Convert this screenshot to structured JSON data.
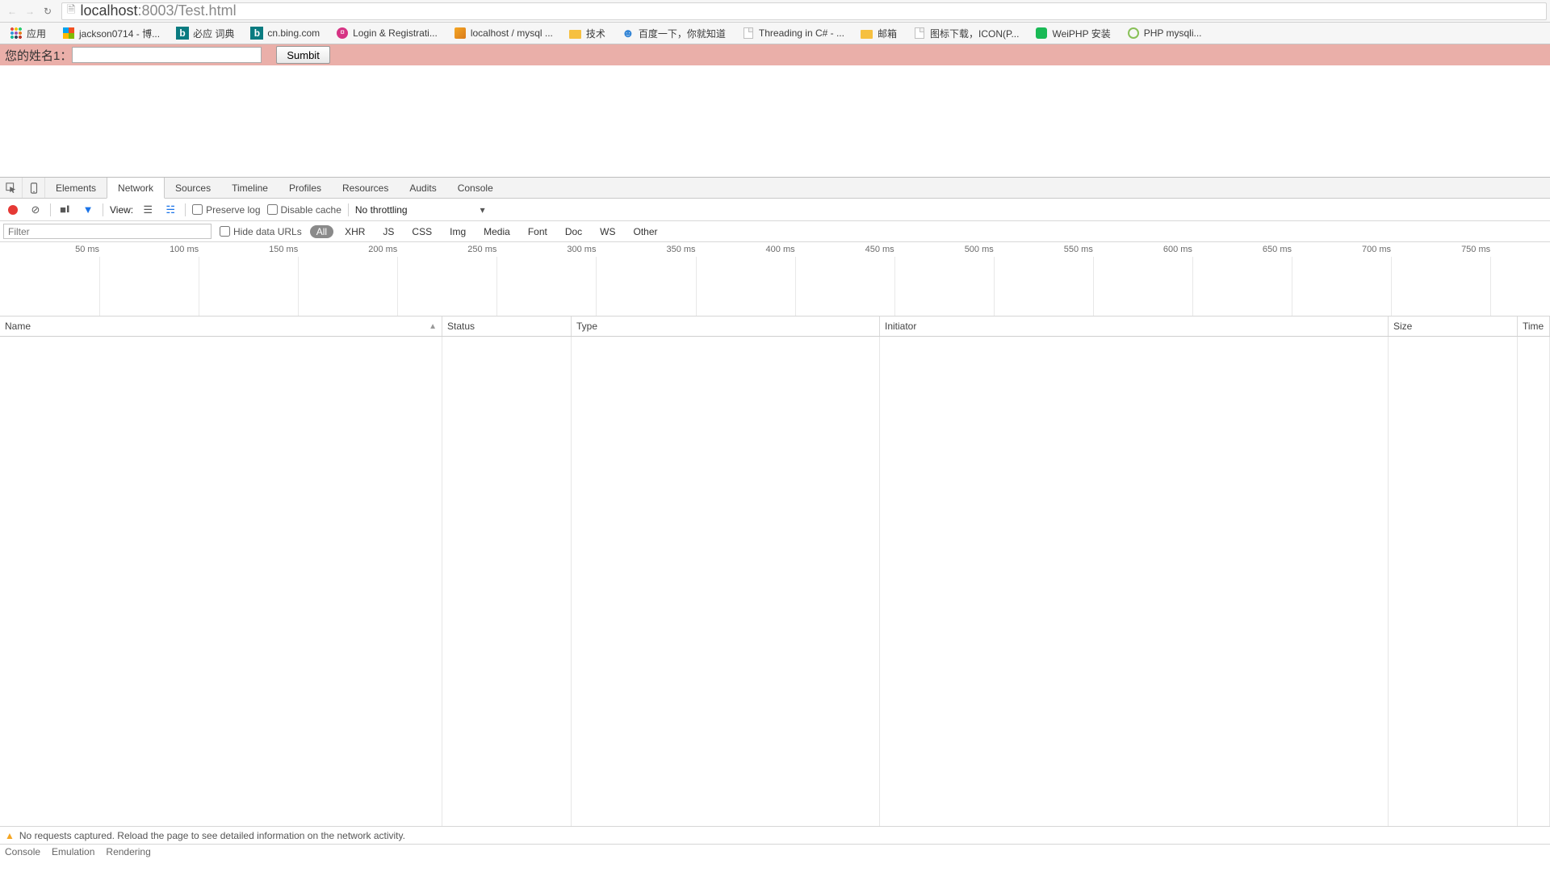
{
  "browser": {
    "url_prefix": "localhost",
    "url_suffix": ":8003/Test.html",
    "bookmarks": [
      {
        "icon": "apps",
        "label": "应用"
      },
      {
        "icon": "ms",
        "label": "jackson0714 - 博..."
      },
      {
        "icon": "bing",
        "label": "必应 词典"
      },
      {
        "icon": "bing",
        "label": "cn.bing.com"
      },
      {
        "icon": "lr",
        "label": "Login & Registrati..."
      },
      {
        "icon": "pma",
        "label": "localhost / mysql ..."
      },
      {
        "icon": "folder",
        "label": "技术"
      },
      {
        "icon": "baidu",
        "label": "百度一下，你就知道"
      },
      {
        "icon": "page",
        "label": "Threading in C# - ..."
      },
      {
        "icon": "folder",
        "label": "邮箱"
      },
      {
        "icon": "page",
        "label": "图标下载，ICON(P..."
      },
      {
        "icon": "green",
        "label": "WeiPHP 安装"
      },
      {
        "icon": "circle",
        "label": "PHP mysqli..."
      }
    ]
  },
  "page": {
    "form_label": "您的姓名1：",
    "input_value": "",
    "button": "Sumbit"
  },
  "devtools": {
    "tabs": [
      "Elements",
      "Network",
      "Sources",
      "Timeline",
      "Profiles",
      "Resources",
      "Audits",
      "Console"
    ],
    "active_tab": "Network",
    "toolbar": {
      "view_label": "View:",
      "preserve": "Preserve log",
      "disable": "Disable cache",
      "throttle": "No throttling"
    },
    "filter": {
      "placeholder": "Filter",
      "hide": "Hide data URLs",
      "types": [
        "All",
        "XHR",
        "JS",
        "CSS",
        "Img",
        "Media",
        "Font",
        "Doc",
        "WS",
        "Other"
      ],
      "active_type": "All"
    },
    "timeline_ticks": [
      "50 ms",
      "100 ms",
      "150 ms",
      "200 ms",
      "250 ms",
      "300 ms",
      "350 ms",
      "400 ms",
      "450 ms",
      "500 ms",
      "550 ms",
      "600 ms",
      "650 ms",
      "700 ms",
      "750 ms"
    ],
    "columns": {
      "name": "Name",
      "status": "Status",
      "type": "Type",
      "initiator": "Initiator",
      "size": "Size",
      "time": "Time"
    },
    "empty_msg": "No requests captured. Reload the page to see detailed information on the network activity.",
    "drawer": [
      "Console",
      "Emulation",
      "Rendering"
    ]
  }
}
